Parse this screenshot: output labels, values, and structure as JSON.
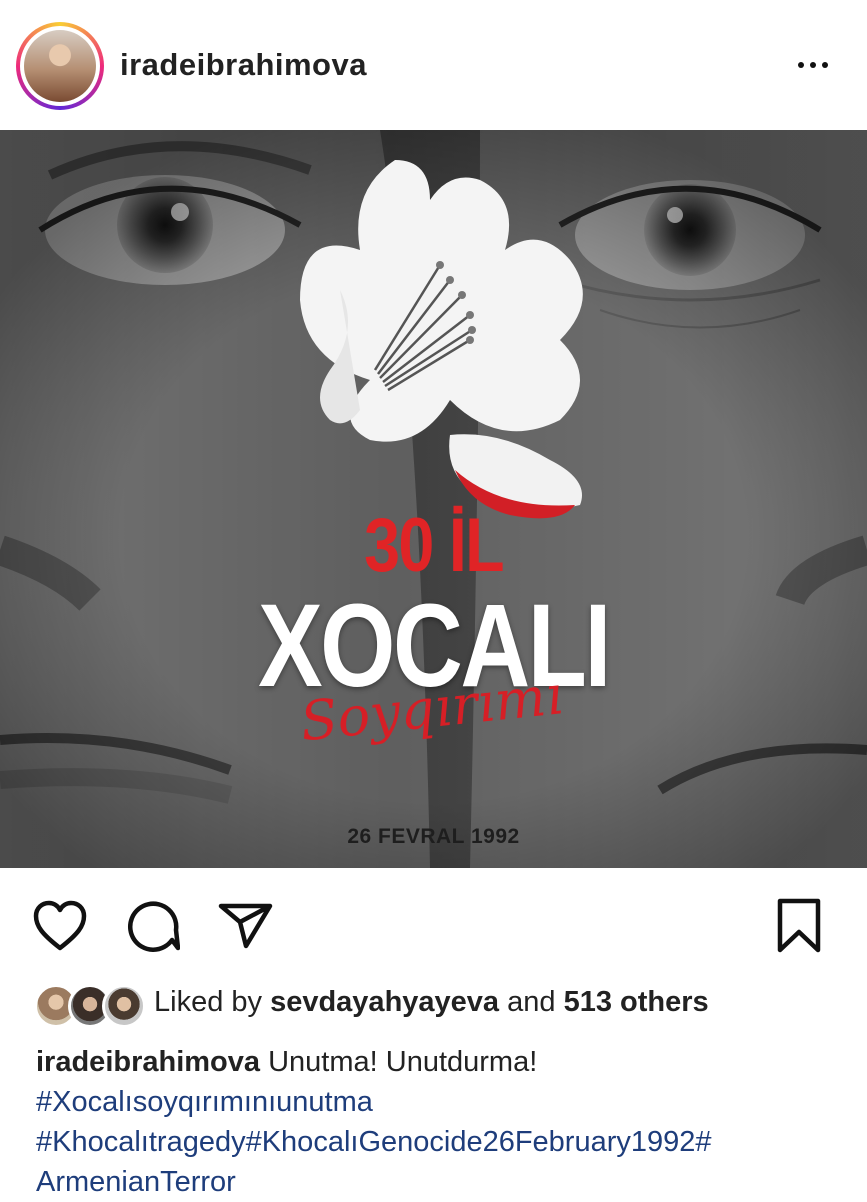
{
  "post_header": {
    "username": "iradeibrahimova",
    "more_icon": "more-horizontal-icon"
  },
  "post_image": {
    "line1": "30 İL",
    "line2": "XOCALI",
    "line3": "Soyqırımı",
    "date": "26 FEVRAL 1992",
    "colors": {
      "accent_red": "#e02426",
      "text_white": "#ffffff",
      "bg_gray": "#555555"
    }
  },
  "actions": {
    "like_icon": "heart-icon",
    "comment_icon": "comment-icon",
    "share_icon": "send-icon",
    "save_icon": "bookmark-icon"
  },
  "likes": {
    "prefix": "Liked by",
    "user": "sevdayahyayeva",
    "middle": "and",
    "others": "513 others"
  },
  "caption": {
    "username": "iradeibrahimova",
    "text": "Unutma! Unutdurma!",
    "hashtags": [
      "#Xocalısoyqırımınıunutma",
      "#Khocalıtragedy#KhocalıGenocide26February1992#",
      "ArmenianTerror"
    ]
  }
}
